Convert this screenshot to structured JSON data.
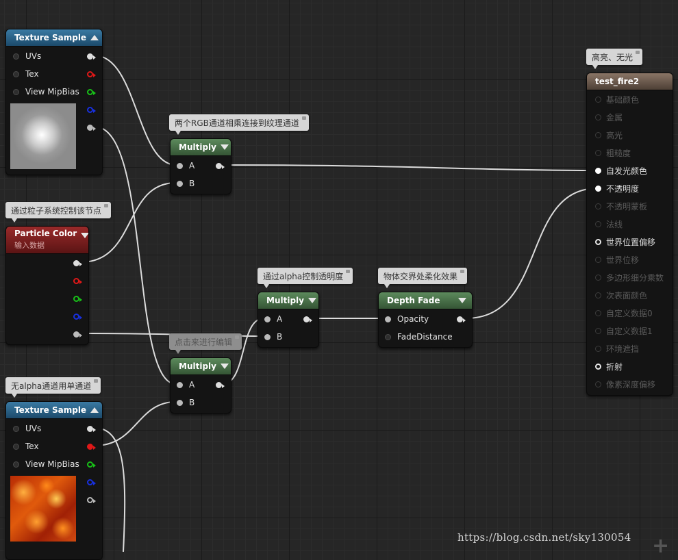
{
  "nodes": {
    "texture_sample_1": {
      "title": "Texture Sample",
      "pins": {
        "uvs": "UVs",
        "tex": "Tex",
        "mip": "View MipBias"
      }
    },
    "particle_color": {
      "title": "Particle Color",
      "subtitle": "输入数据"
    },
    "texture_sample_2": {
      "title": "Texture Sample",
      "pins": {
        "uvs": "UVs",
        "tex": "Tex",
        "mip": "View MipBias"
      }
    },
    "multiply_1": {
      "title": "Multiply",
      "a": "A",
      "b": "B"
    },
    "multiply_2": {
      "title": "Multiply",
      "a": "A",
      "b": "B"
    },
    "multiply_3": {
      "title": "Multiply",
      "a": "A",
      "b": "B"
    },
    "depth_fade": {
      "title": "Depth Fade",
      "opacity": "Opacity",
      "fade_distance": "FadeDistance"
    },
    "material": {
      "title": "test_fire2",
      "inputs": [
        {
          "label": "基础颜色",
          "active": false
        },
        {
          "label": "金属",
          "active": false
        },
        {
          "label": "高光",
          "active": false
        },
        {
          "label": "粗糙度",
          "active": false
        },
        {
          "label": "自发光颜色",
          "active": true
        },
        {
          "label": "不透明度",
          "active": true
        },
        {
          "label": "不透明蒙板",
          "active": false
        },
        {
          "label": "法线",
          "active": false
        },
        {
          "label": "世界位置偏移",
          "active": true
        },
        {
          "label": "世界位移",
          "active": false
        },
        {
          "label": "多边形细分乘数",
          "active": false
        },
        {
          "label": "次表面颜色",
          "active": false
        },
        {
          "label": "自定义数据0",
          "active": false
        },
        {
          "label": "自定义数据1",
          "active": false
        },
        {
          "label": "环境遮挡",
          "active": false
        },
        {
          "label": "折射",
          "active": true
        },
        {
          "label": "像素深度偏移",
          "active": false
        }
      ]
    }
  },
  "comments": {
    "rgb_multiply": "两个RGB通道相乘连接到纹理通道",
    "particle_control": "通过粒子系统控制该节点",
    "alpha_opacity": "通过alpha控制透明度",
    "depth_soft": "物体交界处柔化效果",
    "click_edit": "点击来进行编辑",
    "single_channel": "无alpha通道用单通道",
    "material_note": "高亮、无光"
  },
  "watermark": "https://blog.csdn.net/sky130054",
  "colors": {
    "wire": "#dcdcdc",
    "pin_red": "#e01818",
    "pin_green": "#18c018",
    "pin_blue": "#1830e0",
    "pin_white": "#e0e0e0"
  }
}
